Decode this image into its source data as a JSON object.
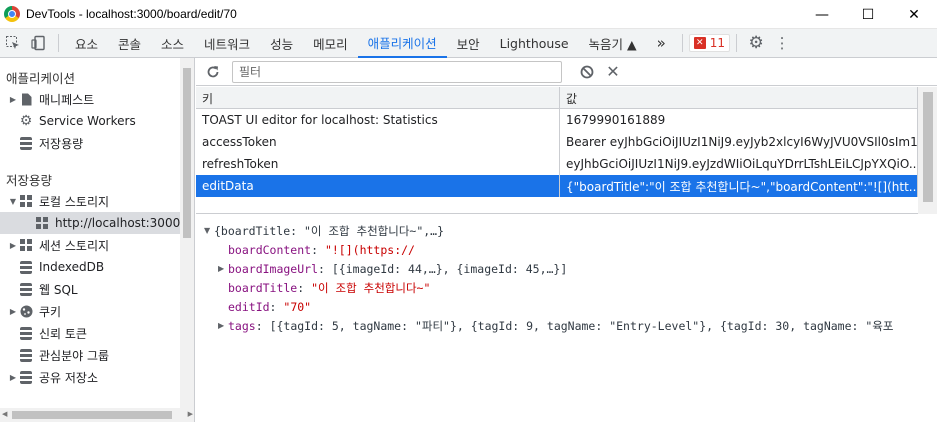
{
  "window": {
    "title": "DevTools - localhost:3000/board/edit/70",
    "minimize": "—",
    "maximize": "☐",
    "close": "✕"
  },
  "tabs": [
    "요소",
    "콘솔",
    "소스",
    "네트워크",
    "성능",
    "메모리",
    "애플리케이션",
    "보안",
    "Lighthouse",
    "녹음기 ▲"
  ],
  "active_tab": "애플리케이션",
  "toolbar": {
    "more": "»",
    "error_count": "11"
  },
  "sidebar": {
    "section1_title": "애플리케이션",
    "app_items": [
      "매니페스트",
      "Service Workers",
      "저장용량"
    ],
    "section2_title": "저장용량",
    "local_storage": "로컬 스토리지",
    "local_origin": "http://localhost:3000",
    "session_storage": "세션 스토리지",
    "indexeddb": "IndexedDB",
    "websql": "웹 SQL",
    "cookies": "쿠키",
    "trust_tokens": "신뢰 토큰",
    "interest_groups": "관심분야 그룹",
    "shared_storage": "공유 저장소"
  },
  "filter": {
    "placeholder": "필터"
  },
  "table": {
    "col_key": "키",
    "col_value": "값",
    "rows": [
      {
        "key": "TOAST UI editor for localhost: Statistics",
        "value": "1679990161889"
      },
      {
        "key": "accessToken",
        "value": "Bearer eyJhbGciOiJIUzI1NiJ9.eyJyb2xlcyI6WyJVU0VSIl0sIm1..."
      },
      {
        "key": "refreshToken",
        "value": "eyJhbGciOiJIUzI1NiJ9.eyJzdWIiOiLquYDrrLTshLEiLCJpYXQiO..."
      },
      {
        "key": "editData",
        "value": "{\"boardTitle\":\"이 조합 추천합니다~\",\"boardContent\":\"![](htt..."
      }
    ],
    "selected_index": 3
  },
  "preview": {
    "root": "{boardTitle: \"이 조합 추천합니다~\",…}",
    "lines": [
      {
        "key": "boardContent",
        "value": "\"![](https://",
        "type": "string",
        "expandable": false
      },
      {
        "key": "boardImageUrl",
        "value": "[{imageId: 44,…}, {imageId: 45,…}]",
        "type": "plain",
        "expandable": true
      },
      {
        "key": "boardTitle",
        "value": "\"이 조합 추천합니다~\"",
        "type": "string",
        "expandable": false
      },
      {
        "key": "editId",
        "value": "\"70\"",
        "type": "string",
        "expandable": false
      },
      {
        "key": "tags",
        "value": "[{tagId: 5, tagName: \"파티\"}, {tagId: 9, tagName: \"Entry-Level\"}, {tagId: 30, tagName: \"육포",
        "type": "plain",
        "expandable": true
      }
    ]
  },
  "colors": {
    "accent": "#1a73e8",
    "error": "#d93025",
    "json_key": "#881280",
    "json_string": "#c80000"
  }
}
